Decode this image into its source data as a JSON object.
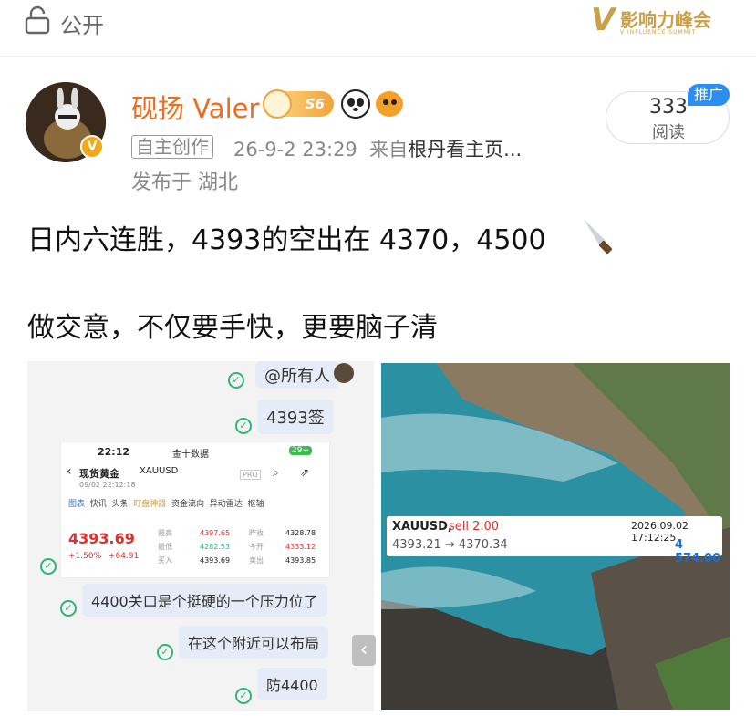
{
  "topbar": {
    "visibility": "公开",
    "brand": "影响力峰会",
    "brand_mark": "V",
    "brand_sub": "V INFLUENCE SUMMIT"
  },
  "post": {
    "author": "砚扬 Valer",
    "level_badge": "S6",
    "tag": "自主创作",
    "time": "26-9-2 23:29",
    "source_prefix": "来自",
    "source": "根丹看主页...",
    "location": "发布于 湖北",
    "reads_count": "333",
    "reads_label": "阅读",
    "promo_label": "推广",
    "text_line1": "日内六连胜，4393的空出在 4370，4500",
    "text_line2": "做交意，不仅要手快，更要脑子清"
  },
  "chat": {
    "msg_mention": "@所有人",
    "msg_short": "4393签",
    "phone_time": "22:12",
    "phone_app": "金十数据",
    "phone_battery": "29+",
    "instrument_name": "现货黄金",
    "instrument_code": "XAUUSD",
    "instrument_datetime": "09/02 22:12:18",
    "pro": "PRO",
    "tabs": [
      "图表",
      "快讯",
      "头条",
      "盯盘神器",
      "资金流向",
      "异动雷达",
      "枢轴"
    ],
    "price": "4393.69",
    "change": "+1.50%",
    "change_abs": "+64.91",
    "quote_labels": [
      "最高",
      "最低",
      "买入",
      "昨收",
      "今开",
      "卖出"
    ],
    "quote_values": [
      "4397.65",
      "4282.53",
      "4393.69",
      "4328.78",
      "4333.12",
      "4393.85"
    ],
    "msg1": "4400关口是个挺硬的一个压力位了",
    "msg2": "在这个附近可以布局",
    "msg3": "防4400"
  },
  "trade": {
    "symbol": "XAUUSD,",
    "side": "sell 2.00",
    "time": "2026.09.02 17:12:25",
    "from_to": "4393.21 → 4370.34",
    "profit": "4 574.00"
  },
  "colors": {
    "accent_orange": "#f26a1b",
    "promo_blue": "#2d8df0",
    "profit_blue": "#1a6fd1",
    "sell_red": "#e0302b"
  }
}
